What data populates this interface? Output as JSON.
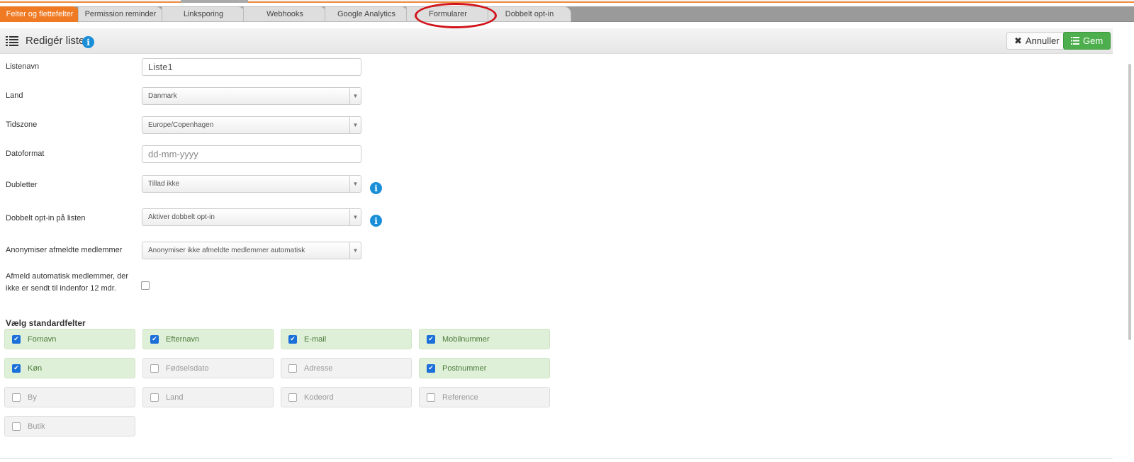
{
  "tabs": [
    {
      "label": "Felter og flettefelter",
      "active": true
    },
    {
      "label": "Permission reminder"
    },
    {
      "label": "Linksporing"
    },
    {
      "label": "Webhooks"
    },
    {
      "label": "Google Analytics"
    },
    {
      "label": "Formularer",
      "highlighted": true
    },
    {
      "label": "Dobbelt opt-in"
    }
  ],
  "header": {
    "title": "Redigér liste",
    "info": "i",
    "cancel": "Annuller",
    "save": "Gem",
    "cancel_icon": "✖",
    "save_icon": "list-icon"
  },
  "form": {
    "listname": {
      "label": "Listenavn",
      "value": "Liste1"
    },
    "country": {
      "label": "Land",
      "value": "Danmark"
    },
    "timezone": {
      "label": "Tidszone",
      "value": "Europe/Copenhagen"
    },
    "dateformat": {
      "label": "Datoformat",
      "placeholder": "dd-mm-yyyy"
    },
    "duplicates": {
      "label": "Dubletter",
      "value": "Tillad ikke"
    },
    "double_optin": {
      "label": "Dobbelt opt-in på listen",
      "value": "Aktiver dobbelt opt-in"
    },
    "anonymize": {
      "label": "Anonymiser afmeldte medlemmer",
      "value": "Anonymiser ikke afmeldte medlemmer automatisk"
    },
    "auto_unsub": {
      "label1": "Afmeld automatisk medlemmer, der",
      "label2": "ikke er sendt til indenfor 12 mdr.",
      "checked": false
    }
  },
  "standard_fields": {
    "title": "Vælg standardfelter",
    "items": [
      {
        "label": "Fornavn",
        "checked": true
      },
      {
        "label": "Efternavn",
        "checked": true
      },
      {
        "label": "E-mail",
        "checked": true
      },
      {
        "label": "Mobilnummer",
        "checked": true
      },
      {
        "label": "Køn",
        "checked": true
      },
      {
        "label": "Fødselsdato",
        "checked": false
      },
      {
        "label": "Adresse",
        "checked": false
      },
      {
        "label": "Postnummer",
        "checked": true
      },
      {
        "label": "By",
        "checked": false
      },
      {
        "label": "Land",
        "checked": false
      },
      {
        "label": "Kodeord",
        "checked": false
      },
      {
        "label": "Reference",
        "checked": false
      },
      {
        "label": "Butik",
        "checked": false
      }
    ]
  },
  "colors": {
    "accent": "#f07a24",
    "save": "#4cae4c",
    "info": "#1a8fd8",
    "checked_bg": "#dff0d8",
    "highlight_circle": "#d0141a"
  }
}
